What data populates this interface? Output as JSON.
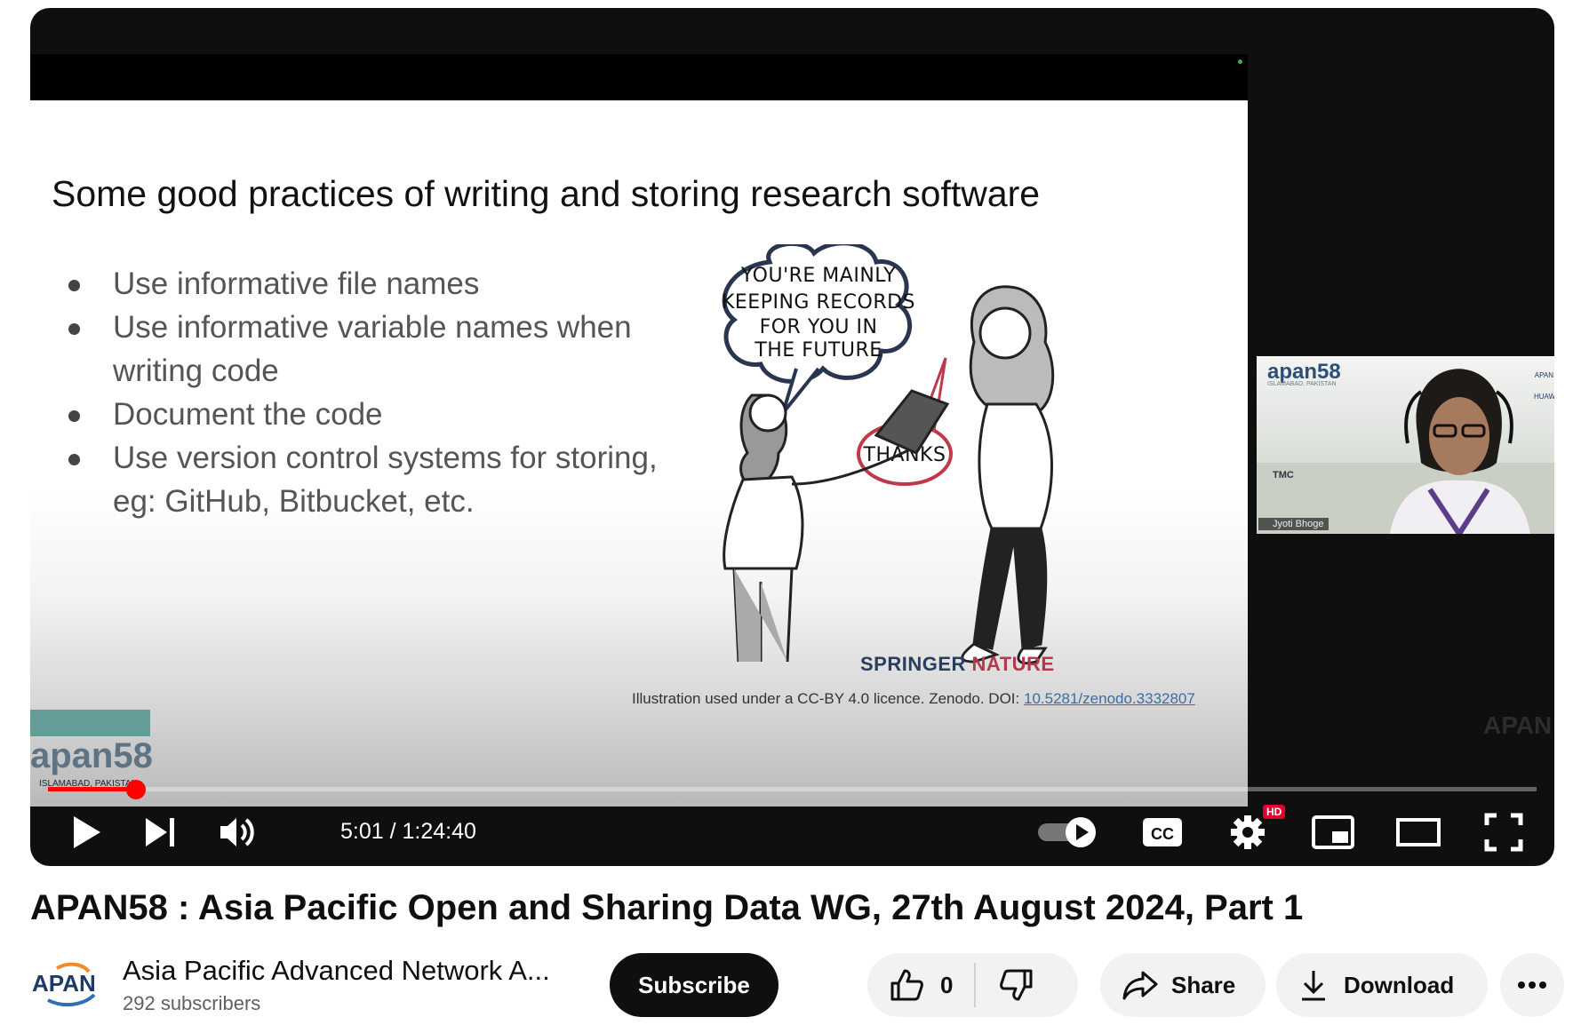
{
  "player": {
    "slide": {
      "title": "Some good practices of writing and storing research software",
      "bullets": [
        "Use informative file names",
        "Use informative variable names when writing code",
        "Document the code",
        "Use version control systems for storing, eg: GitHub, Bitbucket, etc."
      ],
      "speech_bubble": [
        "YOU'RE MAINLY",
        "KEEPING RECORDS",
        "FOR YOU IN",
        "THE FUTURE"
      ],
      "thanks_bubble": "THANKS",
      "publisher_a": "SPRINGER",
      "publisher_b": "NATURE",
      "credit": "Illustration used under a CC-BY 4.0 licence. Zenodo. DOI: ",
      "doi": "10.5281/zenodo.3332807"
    },
    "webcam": {
      "logo": "apan58",
      "sublogo": "ISLAMABAD, PAKISTAN",
      "label": "Jyoti Bhoge",
      "sponsor_text": "TMC",
      "side_logo": "APAN",
      "side_sponsor": "HUAWEI"
    },
    "slide_logo": {
      "top": "apan58",
      "bottom": "ISLAMABAD, PAKISTAN"
    },
    "watermark": "APAN",
    "progress": {
      "current": "5:01",
      "duration": "1:24:40",
      "fraction": 0.0593
    },
    "time_text": "5:01 / 1:24:40",
    "hd_badge": "HD",
    "icons": {
      "play": "play-icon",
      "next": "next-icon",
      "volume": "volume-icon",
      "autoplay": "autoplay-toggle-icon",
      "cc": "cc-icon",
      "settings": "gear-icon",
      "miniplayer": "miniplayer-icon",
      "theater": "theater-icon",
      "fullscreen": "fullscreen-icon"
    },
    "cc_label": "CC"
  },
  "video": {
    "title": "APAN58 : Asia Pacific Open and Sharing Data WG, 27th August 2024, Part 1"
  },
  "channel": {
    "avatar_text": "APAN",
    "name": "Asia Pacific Advanced Network A...",
    "subscribers": "292 subscribers",
    "subscribe_label": "Subscribe"
  },
  "actions": {
    "like_count": "0",
    "share_label": "Share",
    "download_label": "Download"
  },
  "colors": {
    "accent_red": "#ff0000",
    "hd_red": "#e1002d",
    "text_dark": "#0f0f0f",
    "pill_bg": "#f2f2f2"
  }
}
